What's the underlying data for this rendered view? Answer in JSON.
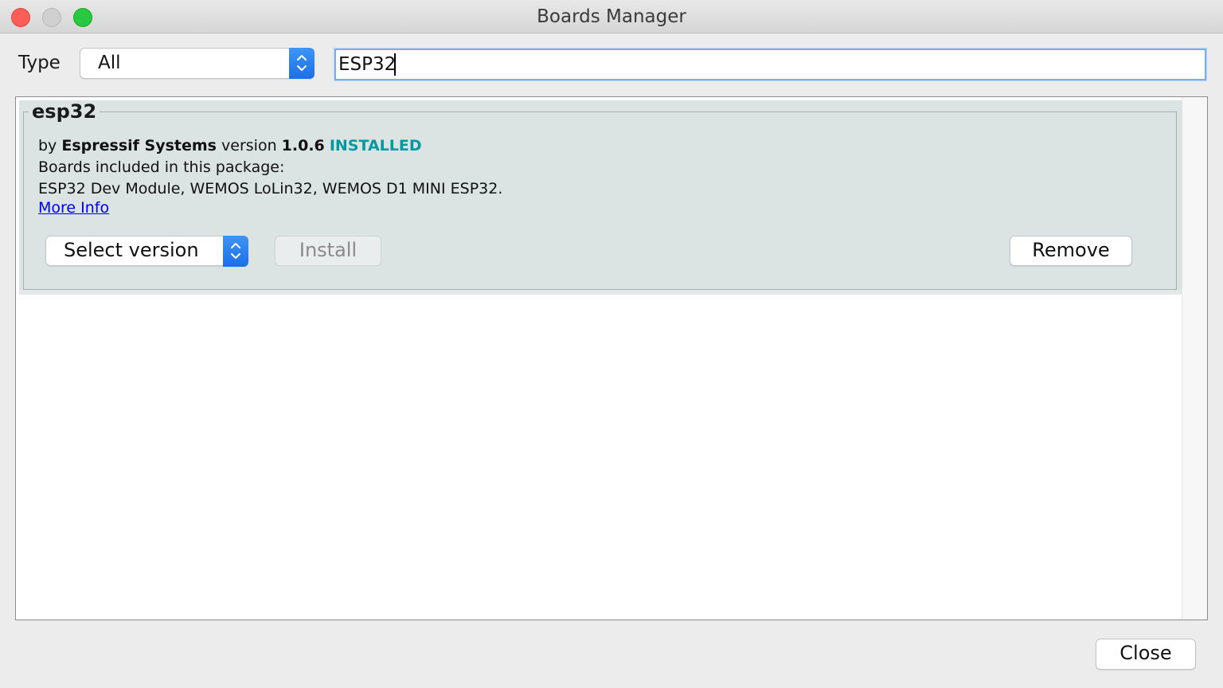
{
  "window": {
    "title": "Boards Manager"
  },
  "filter": {
    "type_label": "Type",
    "type_value": "All",
    "search_value": "ESP32"
  },
  "package": {
    "name": "esp32",
    "by_prefix": "by",
    "author": "Espressif Systems",
    "version_prefix": "version",
    "version": "1.0.6",
    "status": "INSTALLED",
    "boards_heading": "Boards included in this package:",
    "boards_list": "ESP32 Dev Module, WEMOS LoLin32, WEMOS D1 MINI ESP32.",
    "more_info_label": "More Info",
    "select_version_label": "Select version",
    "install_label": "Install",
    "remove_label": "Remove"
  },
  "footer": {
    "close_label": "Close"
  },
  "colors": {
    "installed": "#009aa0",
    "link": "#0000ee",
    "accent": "#1d6fe8",
    "card_bg": "#dbe3e3"
  }
}
